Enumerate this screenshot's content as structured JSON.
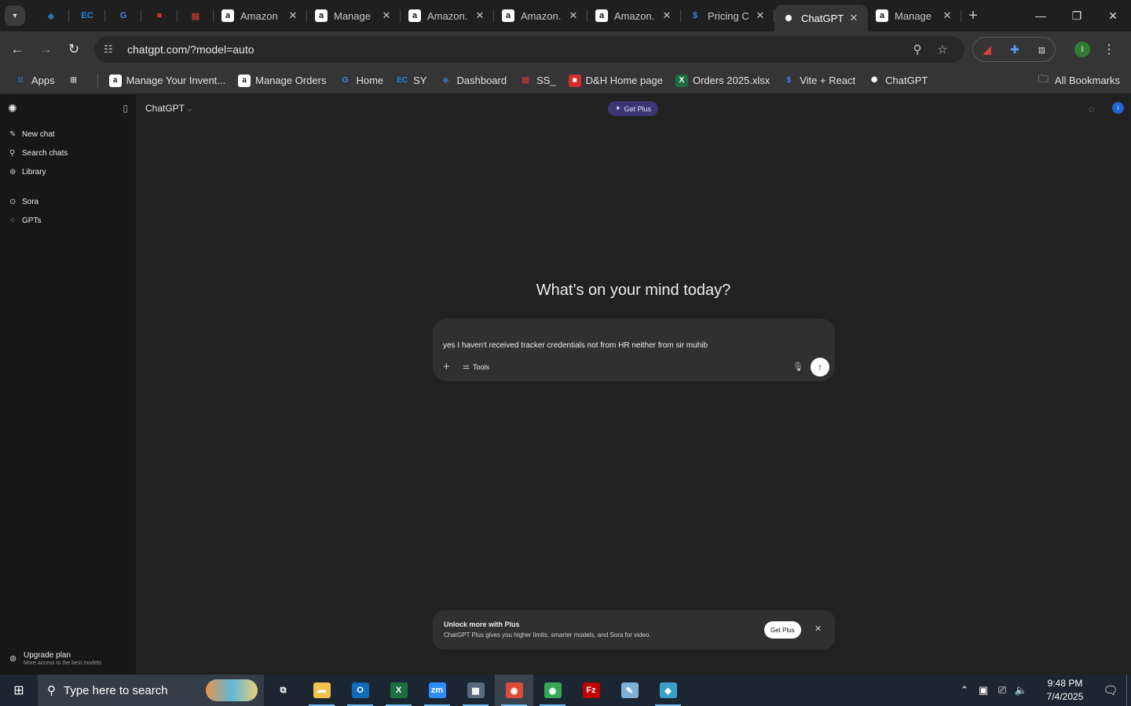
{
  "browser": {
    "tabs": [
      {
        "icon": "tab-favicon-diamond",
        "title": "",
        "color": "#2b6cb0",
        "pinned": true
      },
      {
        "icon": "tab-favicon-ec",
        "title": "",
        "color": "#1e88e5",
        "pinned": true
      },
      {
        "icon": "tab-favicon-g",
        "title": "",
        "color": "#4285f4",
        "pinned": true
      },
      {
        "icon": "tab-favicon-dh",
        "title": "",
        "color": "#d32f2f",
        "pinned": true
      },
      {
        "icon": "tab-favicon-box",
        "title": "",
        "color": "#c0392b",
        "pinned": true
      },
      {
        "icon": "tab-favicon-amazon",
        "title": "Amazon",
        "color": "#ffffff"
      },
      {
        "icon": "tab-favicon-amazon",
        "title": "Manage",
        "color": "#ffffff"
      },
      {
        "icon": "tab-favicon-amazon",
        "title": "Amazon.",
        "color": "#ffffff"
      },
      {
        "icon": "tab-favicon-amazon",
        "title": "Amazon.",
        "color": "#ffffff"
      },
      {
        "icon": "tab-favicon-amazon",
        "title": "Amazon.",
        "color": "#ffffff"
      },
      {
        "icon": "tab-favicon-dollar",
        "title": "Pricing C",
        "color": "#3b82f6"
      },
      {
        "icon": "tab-favicon-chatgpt",
        "title": "ChatGPT",
        "color": "#ffffff",
        "active": true
      },
      {
        "icon": "tab-favicon-amazon",
        "title": "Manage",
        "color": "#ffffff"
      }
    ],
    "url": "chatgpt.com/?model=auto",
    "bookmarks": [
      {
        "label": "Apps",
        "icon": "apps-grid-icon",
        "color": "#4285f4"
      },
      {
        "label": "",
        "icon": "tab-groups-icon",
        "color": "#c7c7c7"
      },
      {
        "label": "Manage Your Invent...",
        "icon": "amazon-icon",
        "color": "#ffffff"
      },
      {
        "label": "Manage Orders",
        "icon": "amazon-icon",
        "color": "#ffffff"
      },
      {
        "label": "Home",
        "icon": "g-icon",
        "color": "#4285f4"
      },
      {
        "label": "SY",
        "icon": "ec-icon",
        "color": "#1e88e5"
      },
      {
        "label": "Dashboard",
        "icon": "diamond-icon",
        "color": "#2b6cb0"
      },
      {
        "label": "SS_",
        "icon": "box-icon",
        "color": "#c0392b"
      },
      {
        "label": "D&H Home page",
        "icon": "dh-icon",
        "color": "#d32f2f"
      },
      {
        "label": "Orders 2025.xlsx",
        "icon": "excel-icon",
        "color": "#1d6f42"
      },
      {
        "label": "Vite + React",
        "icon": "dollar-icon",
        "color": "#3b82f6"
      },
      {
        "label": "ChatGPT",
        "icon": "chatgpt-icon",
        "color": "#ffffff"
      }
    ],
    "all_bookmarks": "All Bookmarks",
    "profile_initial": "i"
  },
  "sidebar": {
    "items": [
      {
        "label": "New chat",
        "icon": "edit-icon"
      },
      {
        "label": "Search chats",
        "icon": "search-icon"
      },
      {
        "label": "Library",
        "icon": "library-icon"
      }
    ],
    "items2": [
      {
        "label": "Sora",
        "icon": "play-icon"
      },
      {
        "label": "GPTs",
        "icon": "grid-icon"
      }
    ],
    "upgrade_title": "Upgrade plan",
    "upgrade_subtitle": "More access to the best models"
  },
  "main": {
    "model_selector": "ChatGPT",
    "get_plus": "Get Plus",
    "avatar_initial": "i",
    "headline": "What’s on your mind today?",
    "composer_text": "yes I haven't received tracker credentials not from HR neither from sir muhib",
    "tools_label": "Tools"
  },
  "promo": {
    "title": "Unlock more with Plus",
    "body": "ChatGPT Plus gives you higher limits, smarter models, and Sora for video.",
    "button": "Get Plus"
  },
  "taskbar": {
    "search_placeholder": "Type here to search",
    "time": "9:48 PM",
    "date": "7/4/2025",
    "apps": [
      {
        "name": "task-view-icon",
        "glyph": "⧉",
        "color": "#ffffff",
        "running": false
      },
      {
        "name": "file-explorer-icon",
        "glyph": "▬",
        "color": "#f2c14e",
        "running": true
      },
      {
        "name": "outlook-icon",
        "glyph": "O",
        "color": "#0f6cbd",
        "running": true
      },
      {
        "name": "excel-icon",
        "glyph": "X",
        "color": "#1d6f42",
        "running": true
      },
      {
        "name": "zoom-icon",
        "glyph": "zm",
        "color": "#2d8cff",
        "running": true
      },
      {
        "name": "calculator-icon",
        "glyph": "▦",
        "color": "#5b6b7f",
        "running": true
      },
      {
        "name": "chrome-icon",
        "glyph": "◉",
        "color": "#dd4b39",
        "running": true,
        "active": true
      },
      {
        "name": "chrome-profile-icon",
        "glyph": "◉",
        "color": "#34a853",
        "running": true
      },
      {
        "name": "filezilla-icon",
        "glyph": "Fz",
        "color": "#bf0000",
        "running": false
      },
      {
        "name": "notepad-icon",
        "glyph": "✎",
        "color": "#7fb0d8",
        "running": false
      },
      {
        "name": "app-diamond-icon",
        "glyph": "◆",
        "color": "#3aa0c8",
        "running": true
      }
    ]
  }
}
